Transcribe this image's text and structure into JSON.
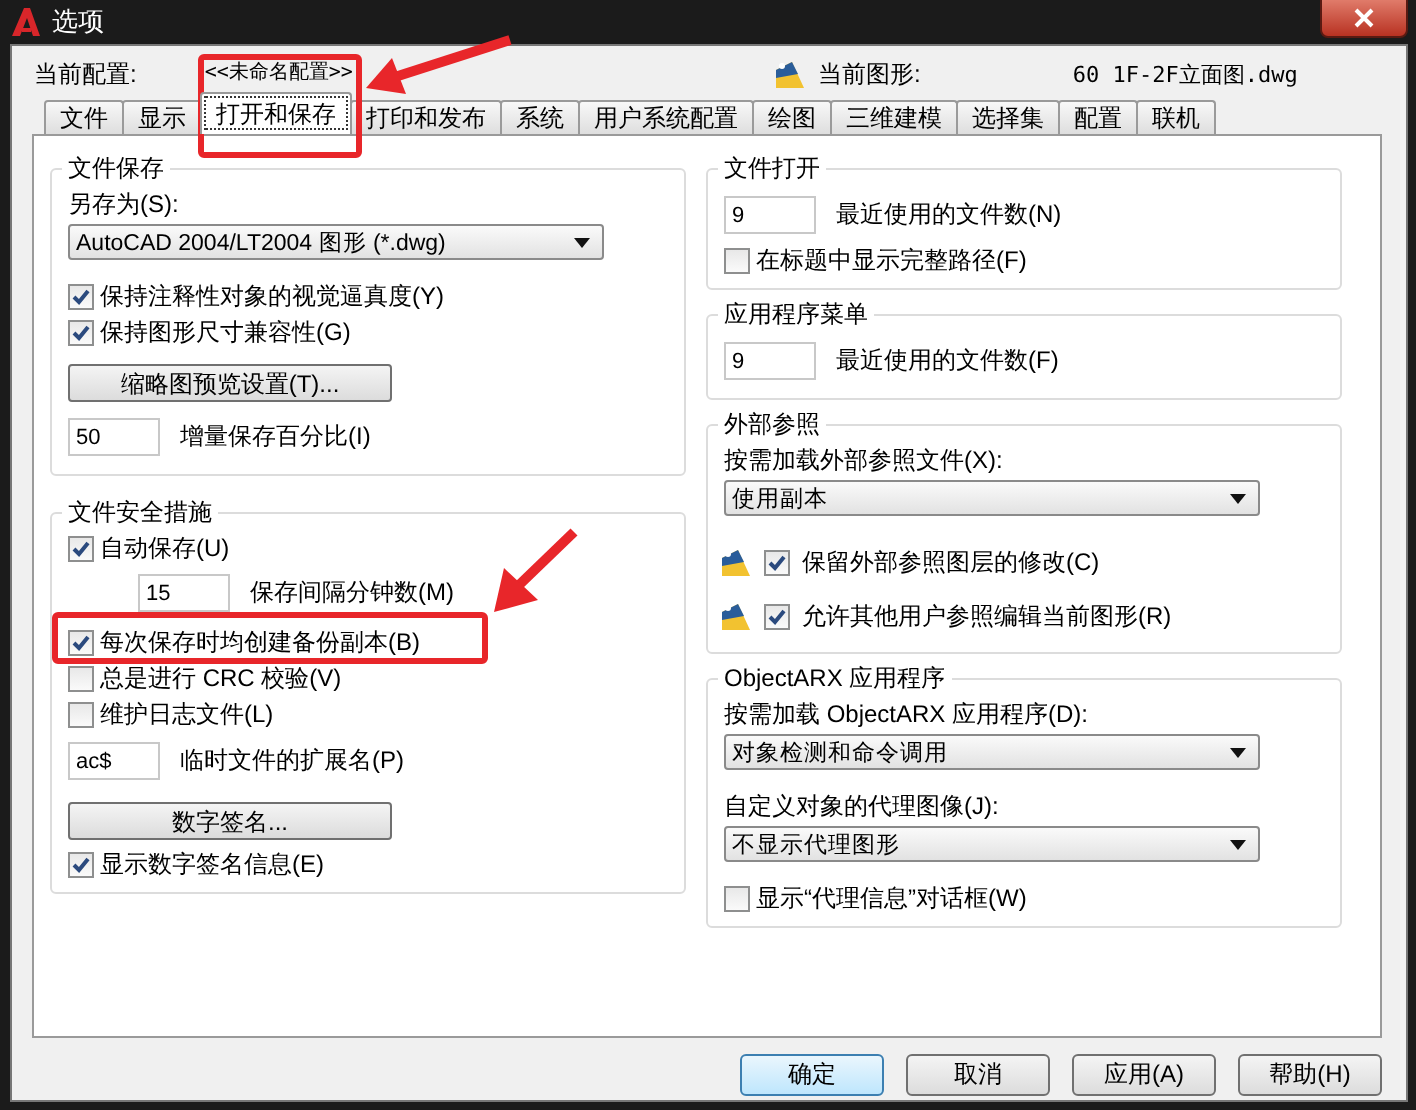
{
  "window": {
    "title": "选项"
  },
  "profile": {
    "label": "当前配置:",
    "value": "<<未命名配置>>"
  },
  "drawing": {
    "label": "当前图形:",
    "value": "60 1F-2F立面图.dwg"
  },
  "tabs": [
    {
      "label": "文件",
      "selected": false
    },
    {
      "label": "显示",
      "selected": false
    },
    {
      "label": "打开和保存",
      "selected": true
    },
    {
      "label": "打印和发布",
      "selected": false
    },
    {
      "label": "系统",
      "selected": false
    },
    {
      "label": "用户系统配置",
      "selected": false
    },
    {
      "label": "绘图",
      "selected": false
    },
    {
      "label": "三维建模",
      "selected": false
    },
    {
      "label": "选择集",
      "selected": false
    },
    {
      "label": "配置",
      "selected": false
    },
    {
      "label": "联机",
      "selected": false
    }
  ],
  "left_groups": [
    {
      "title": "文件保存",
      "items": [
        {
          "kind": "label",
          "text": "另存为(S):"
        },
        {
          "kind": "select",
          "value": "AutoCAD 2004/LT2004 图形 (*.dwg)"
        },
        {
          "kind": "checkbox",
          "text": "保持注释性对象的视觉逼真度(Y)",
          "checked": true
        },
        {
          "kind": "checkbox",
          "text": "保持图形尺寸兼容性(G)",
          "checked": true
        },
        {
          "kind": "button",
          "text": "缩略图预览设置(T)..."
        },
        {
          "kind": "input",
          "value": "50",
          "label": "增量保存百分比(I)"
        }
      ]
    },
    {
      "title": "文件安全措施",
      "items": [
        {
          "kind": "checkbox",
          "text": "自动保存(U)",
          "checked": true
        },
        {
          "kind": "sub_input",
          "value": "15",
          "label": "保存间隔分钟数(M)"
        },
        {
          "kind": "checkbox",
          "text": "每次保存时均创建备份副本(B)",
          "checked": true
        },
        {
          "kind": "checkbox",
          "text": "总是进行 CRC 校验(V)",
          "checked": false
        },
        {
          "kind": "checkbox",
          "text": "维护日志文件(L)",
          "checked": false
        },
        {
          "kind": "input",
          "value": "ac$",
          "label": "临时文件的扩展名(P)"
        },
        {
          "kind": "button",
          "text": "数字签名..."
        },
        {
          "kind": "checkbox",
          "text": "显示数字签名信息(E)",
          "checked": true
        }
      ]
    }
  ],
  "right_groups": [
    {
      "title": "文件打开",
      "items": [
        {
          "kind": "input",
          "value": "9",
          "label": "最近使用的文件数(N)"
        },
        {
          "kind": "checkbox",
          "text": "在标题中显示完整路径(F)",
          "checked": false
        }
      ]
    },
    {
      "title": "应用程序菜单",
      "items": [
        {
          "kind": "input",
          "value": "9",
          "label": "最近使用的文件数(F)"
        }
      ]
    },
    {
      "title": "外部参照",
      "items": [
        {
          "kind": "label",
          "text": "按需加载外部参照文件(X):"
        },
        {
          "kind": "select",
          "value": "使用副本"
        },
        {
          "kind": "xref_checkbox",
          "text": "保留外部参照图层的修改(C)",
          "checked": true
        },
        {
          "kind": "xref_checkbox",
          "text": "允许其他用户参照编辑当前图形(R)",
          "checked": true
        }
      ]
    },
    {
      "title": "ObjectARX 应用程序",
      "items": [
        {
          "kind": "label",
          "text": "按需加载 ObjectARX 应用程序(D):"
        },
        {
          "kind": "select",
          "value": "对象检测和命令调用"
        },
        {
          "kind": "label",
          "text": "自定义对象的代理图像(J):"
        },
        {
          "kind": "select",
          "value": "不显示代理图形"
        },
        {
          "kind": "checkbox",
          "text": "显示“代理信息”对话框(W)",
          "checked": false
        }
      ]
    }
  ],
  "buttons": [
    {
      "label": "确定",
      "default": true
    },
    {
      "label": "取消",
      "default": false
    },
    {
      "label": "应用(A)",
      "default": false
    },
    {
      "label": "帮助(H)",
      "default": false
    }
  ]
}
